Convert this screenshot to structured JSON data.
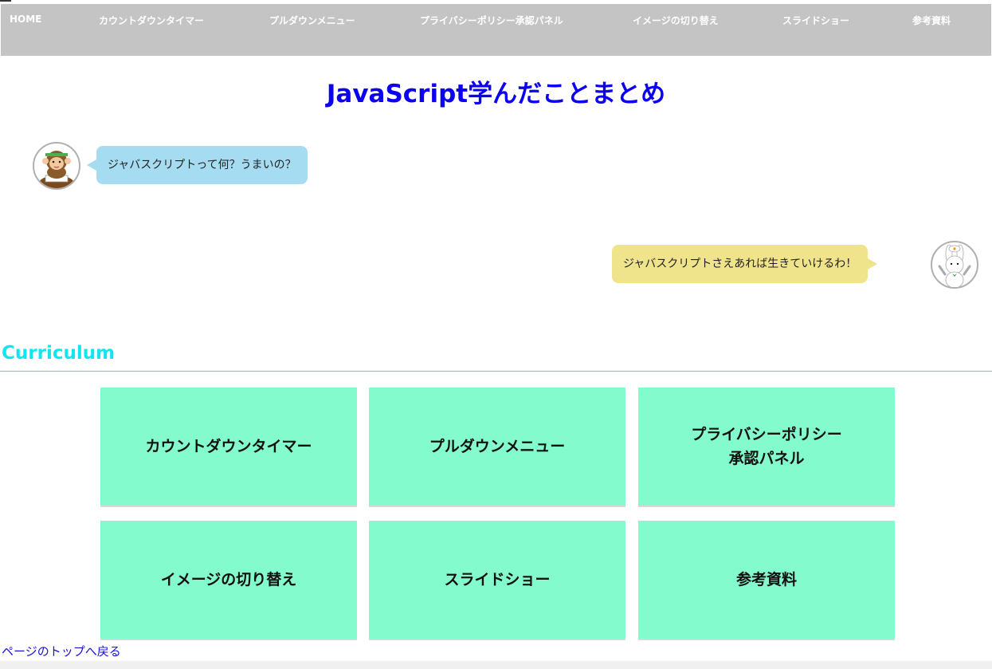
{
  "nav": {
    "items": [
      {
        "label": "HOME"
      },
      {
        "label": "カウントダウンタイマー"
      },
      {
        "label": "プルダウンメニュー"
      },
      {
        "label": "プライバシーポリシー承認パネル"
      },
      {
        "label": "イメージの切り替え"
      },
      {
        "label": "スライドショー"
      },
      {
        "label": "参考資料"
      }
    ]
  },
  "page": {
    "title": "JavaScript学んだことまとめ"
  },
  "chat": {
    "left": {
      "avatar_icon": "monkey-studying-icon",
      "text": "ジャバスクリプトって何？うまいの？",
      "color": "#a6dcf2"
    },
    "right": {
      "avatar_icon": "rabbit-chef-icon",
      "text": "ジャバスクリプトさえあれば生きていけるわ！",
      "color": "#efe38c"
    }
  },
  "curriculum": {
    "heading": "Curriculum",
    "cards": [
      {
        "label": "カウントダウンタイマー"
      },
      {
        "label": "プルダウンメニュー"
      },
      {
        "label": "プライバシーポリシー\n承認パネル"
      },
      {
        "label": "イメージの切り替え"
      },
      {
        "label": "スライドショー"
      },
      {
        "label": "参考資料"
      }
    ]
  },
  "footer": {
    "back_to_top": "ページのトップへ戻る"
  },
  "colors": {
    "nav_bg": "#c4c4c4",
    "title": "#0b00f0",
    "heading": "#11e6f0",
    "card_bg": "#83fbcc",
    "link": "#1a12d6"
  }
}
